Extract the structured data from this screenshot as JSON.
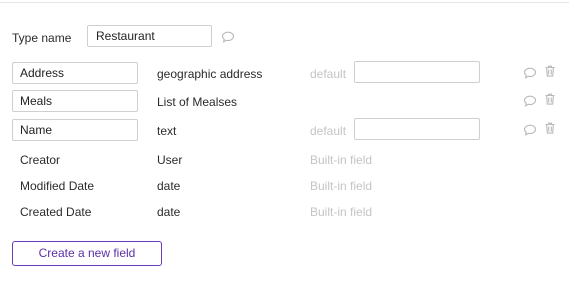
{
  "type": {
    "label": "Type name",
    "value": "Restaurant"
  },
  "fields": [
    {
      "name": "Address",
      "type": "geographic address",
      "default_label": "default",
      "default_value": ""
    },
    {
      "name": "Meals",
      "type": "List of Mealses"
    },
    {
      "name": "Name",
      "type": "text",
      "default_label": "default",
      "default_value": ""
    }
  ],
  "builtin_fields": [
    {
      "name": "Creator",
      "type": "User",
      "note": "Built-in field"
    },
    {
      "name": "Modified Date",
      "type": "date",
      "note": "Built-in field"
    },
    {
      "name": "Created Date",
      "type": "date",
      "note": "Built-in field"
    }
  ],
  "actions": {
    "create_field_label": "Create a new field"
  },
  "icons": {
    "comment": "comment-icon",
    "trash": "trash-icon"
  },
  "colors": {
    "accent": "#6c3db5",
    "muted_text": "#c4c4c4",
    "icon": "#b9b9b9"
  }
}
